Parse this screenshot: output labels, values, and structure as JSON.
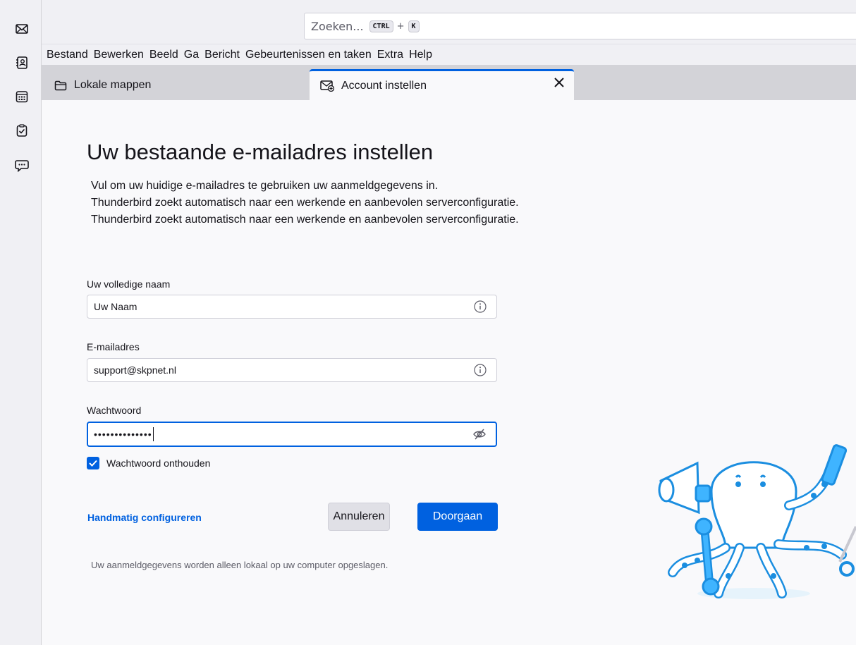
{
  "spaces": {
    "items": [
      {
        "name": "mail-icon"
      },
      {
        "name": "address-book-icon"
      },
      {
        "name": "calendar-icon"
      },
      {
        "name": "tasks-icon"
      },
      {
        "name": "chat-icon"
      }
    ]
  },
  "search": {
    "placeholder": "Zoeken...",
    "shortcut_key1": "CTRL",
    "shortcut_plus": "+",
    "shortcut_key2": "K"
  },
  "menubar": {
    "items": [
      "Bestand",
      "Bewerken",
      "Beeld",
      "Ga",
      "Bericht",
      "Gebeurtenissen en taken",
      "Extra",
      "Help"
    ]
  },
  "tabs": [
    {
      "label": "Lokale mappen",
      "icon": "folder-icon",
      "active": false
    },
    {
      "label": "Account instellen",
      "icon": "account-setup-icon",
      "active": true
    }
  ],
  "form": {
    "title": "Uw bestaande e-mailadres instellen",
    "desc_lines": [
      "Vul om uw huidige e-mailadres te gebruiken uw aanmeldgegevens in.",
      "Thunderbird zoekt automatisch naar een werkende en aanbevolen serverconfiguratie.",
      "Thunderbird zoekt automatisch naar een werkende en aanbevolen serverconfiguratie."
    ],
    "name_label": "Uw volledige naam",
    "name_value": "Uw Naam",
    "email_label": "E-mailadres",
    "email_value": "support@skpnet.nl",
    "password_label": "Wachtwoord",
    "password_value": "••••••••••••••",
    "remember_label": "Wachtwoord onthouden",
    "remember_checked": true,
    "manual_link": "Handmatig configureren",
    "cancel_label": "Annuleren",
    "continue_label": "Doorgaan",
    "footnote": "Uw aanmeldgegevens worden alleen lokaal op uw computer opgeslagen."
  },
  "colors": {
    "accent": "#0061e0",
    "background": "#f9f9fb",
    "toolbar": "#f0f0f4",
    "tabbar": "#d3d3d8"
  }
}
